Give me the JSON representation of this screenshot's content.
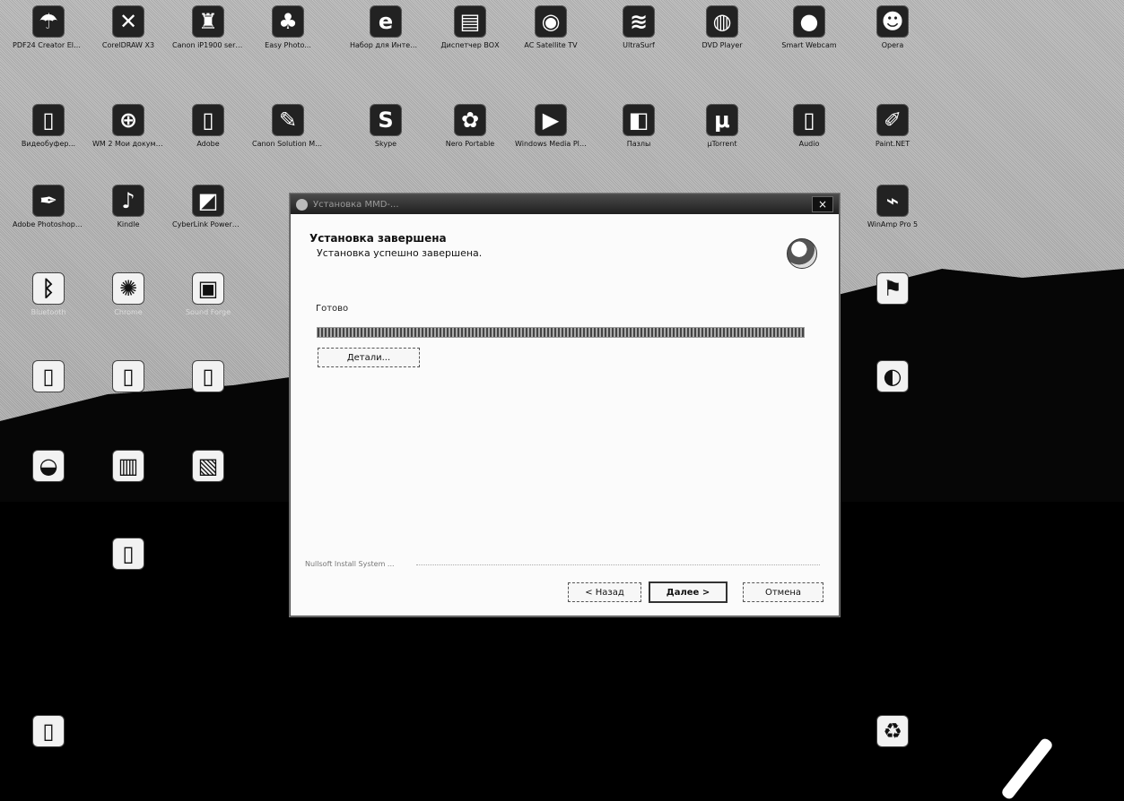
{
  "desktop": {
    "row1": [
      {
        "label": "PDF24 Creator Elements",
        "glyph": "☂"
      },
      {
        "label": "CorelDRAW X3",
        "glyph": "✕"
      },
      {
        "label": "Canon iP1900 series - ser...",
        "glyph": "♜"
      },
      {
        "label": "Easy Photo...",
        "glyph": "♣"
      },
      {
        "label": "Набор для Интернета",
        "glyph": "e"
      },
      {
        "label": "Диспетчер ВОХ",
        "glyph": "▤"
      },
      {
        "label": "AC Satellite TV",
        "glyph": "◉"
      },
      {
        "label": "UltraSurf",
        "glyph": "≋"
      },
      {
        "label": "DVD Player",
        "glyph": "◍"
      },
      {
        "label": "Smart Webcam",
        "glyph": "●"
      },
      {
        "label": "Opera",
        "glyph": "☻"
      }
    ],
    "row2": [
      {
        "label": "Видеобуфер...",
        "glyph": "▯"
      },
      {
        "label": "WM 2 Мои документы",
        "glyph": "⊕"
      },
      {
        "label": "Adobe",
        "glyph": "▯"
      },
      {
        "label": "Canon Solution Menu",
        "glyph": "✎"
      },
      {
        "label": "Skype",
        "glyph": "S"
      },
      {
        "label": "Nero Portable",
        "glyph": "✿"
      },
      {
        "label": "Windows Media Player",
        "glyph": "▶"
      },
      {
        "label": "Пазлы",
        "glyph": "◧"
      },
      {
        "label": "µTorrent",
        "glyph": "μ"
      },
      {
        "label": "Audio",
        "glyph": "▯"
      },
      {
        "label": "Paint.NET",
        "glyph": "✐"
      }
    ],
    "row3": [
      {
        "label": "Adobe Photoshop CS5",
        "glyph": "✒"
      },
      {
        "label": "Kindle",
        "glyph": "♪"
      },
      {
        "label": "CyberLink PowerDVD",
        "glyph": "◩"
      },
      {
        "label": "WinAmp Pro 5",
        "glyph": "⌁"
      }
    ],
    "row4": [
      {
        "label": "Bluetooth",
        "glyph": "ᛒ"
      },
      {
        "label": "Chrome",
        "glyph": "✺"
      },
      {
        "label": "Sound Forge",
        "glyph": "▣"
      },
      {
        "label": "",
        "glyph": "⚑"
      }
    ],
    "lower": [
      {
        "label": "",
        "glyph": "▯"
      },
      {
        "label": "",
        "glyph": "▯"
      },
      {
        "label": "",
        "glyph": "▯"
      },
      {
        "label": "",
        "glyph": "◐"
      },
      {
        "label": "",
        "glyph": "◒"
      },
      {
        "label": "",
        "glyph": "▥"
      },
      {
        "label": "",
        "glyph": "▧"
      },
      {
        "label": "",
        "glyph": "▯"
      },
      {
        "label": "",
        "glyph": "▯"
      },
      {
        "label": "",
        "glyph": "♻"
      }
    ]
  },
  "dialog": {
    "title": "Установка MMD-...",
    "close": "×",
    "header_title": "Установка завершена",
    "header_subtitle": "Установка успешно завершена.",
    "status_label": "Готово",
    "progress": 1.0,
    "details_button": "Детали...",
    "brand": "Nullsoft Install System ...",
    "back_button": "< Назад",
    "next_button": "Далее >",
    "cancel_button": "Отмена"
  }
}
